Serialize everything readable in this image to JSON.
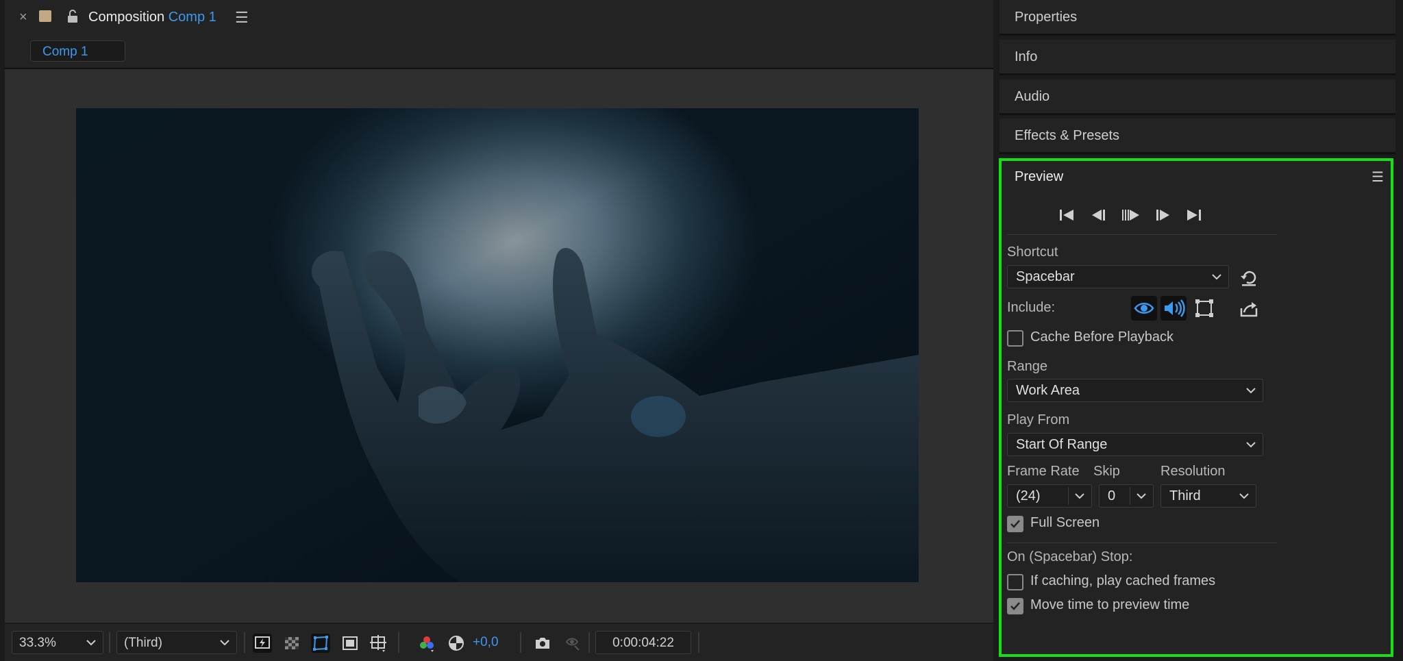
{
  "composition": {
    "close_glyph": "×",
    "title_prefix": "Composition",
    "title_comp": "Comp 1",
    "menu_glyph": "☰",
    "tab_label": "Comp 1"
  },
  "comp_toolbar": {
    "zoom_value": "33.3%",
    "resolution_value": "(Third)",
    "exposure_value": "+0,0",
    "timecode": "0:00:04:22",
    "icons": [
      "fast-previews-icon",
      "transparency-grid-icon",
      "mask-visibility-icon",
      "region-of-interest-icon",
      "grid-guides-icon",
      "color-channels-icon",
      "color-management-icon",
      "snapshot-icon",
      "show-snapshot-icon"
    ]
  },
  "panels": {
    "properties": "Properties",
    "info": "Info",
    "audio": "Audio",
    "effects_presets": "Effects & Presets"
  },
  "preview": {
    "title": "Preview",
    "menu_glyph": "☰",
    "shortcut_label": "Shortcut",
    "shortcut_value": "Spacebar",
    "include_label": "Include:",
    "cache_before_playback": "Cache Before Playback",
    "cache_before_playback_checked": false,
    "range_label": "Range",
    "range_value": "Work Area",
    "play_from_label": "Play From",
    "play_from_value": "Start Of Range",
    "frame_rate_label": "Frame Rate",
    "frame_rate_value": "(24)",
    "skip_label": "Skip",
    "skip_value": "0",
    "resolution_label": "Resolution",
    "resolution_value": "Third",
    "full_screen": "Full Screen",
    "full_screen_checked": true,
    "on_stop_label": "On (Spacebar) Stop:",
    "if_caching": "If caching, play cached frames",
    "if_caching_checked": false,
    "move_time": "Move time to preview time",
    "move_time_checked": true
  },
  "colors": {
    "accent": "#3b9af0",
    "highlight_border": "#14e014",
    "panel_bg": "#232323"
  }
}
